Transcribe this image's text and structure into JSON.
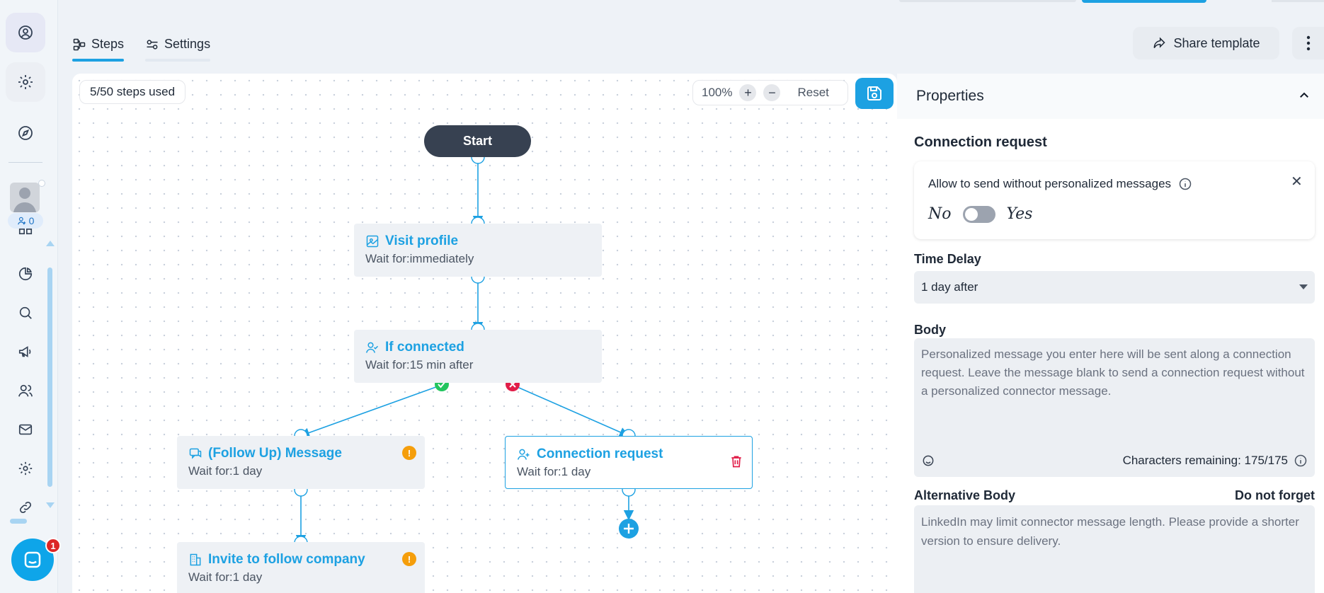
{
  "tabs": [
    {
      "label": "Steps",
      "active": true
    },
    {
      "label": "Settings",
      "active": false
    }
  ],
  "header": {
    "share_label": "Share template"
  },
  "sidebar": {
    "connections_count": "0"
  },
  "notifications": {
    "chat_badge": "1"
  },
  "canvas": {
    "steps_used": "5/50 steps used",
    "zoom_level": "100%",
    "zoom_in": "+",
    "zoom_out": "−",
    "reset_label": "Reset",
    "start_label": "Start",
    "nodes": [
      {
        "title": "Visit profile",
        "wait": "Wait for:immediately",
        "icon": "visit-profile-icon"
      },
      {
        "title": "If connected",
        "wait": "Wait for:15 min after",
        "icon": "user-check-icon"
      },
      {
        "title": "(Follow Up) Message",
        "wait": "Wait for:1 day",
        "icon": "message-icon",
        "warning": "!"
      },
      {
        "title": "Connection request",
        "wait": "Wait for:1 day",
        "icon": "user-plus-icon",
        "selected": true
      },
      {
        "title": "Invite to follow company",
        "wait": "Wait for:1 day",
        "icon": "company-icon",
        "warning": "!"
      }
    ]
  },
  "properties": {
    "header": "Properties",
    "section_title": "Connection request",
    "allow_text": "Allow to send without personalized messages",
    "toggle_no": "No",
    "toggle_yes": "Yes",
    "time_delay_label": "Time Delay",
    "time_delay_value": "1 day after",
    "body_label": "Body",
    "body_placeholder": "Personalized message you enter here will be sent along a connection request. Leave the message blank to send a connection request without a personalized connector message.",
    "chars_remaining": "Characters remaining: 175/175",
    "alt_body_label": "Alternative Body",
    "alt_body_hint": "Do not forget",
    "alt_body_placeholder": "LinkedIn may limit connector message length. Please provide a shorter version to ensure delivery."
  },
  "colors": {
    "accent": "#1da1e2",
    "start_node": "#374151",
    "success": "#22c55e",
    "danger": "#e11d48",
    "warning": "#f59e0b"
  }
}
